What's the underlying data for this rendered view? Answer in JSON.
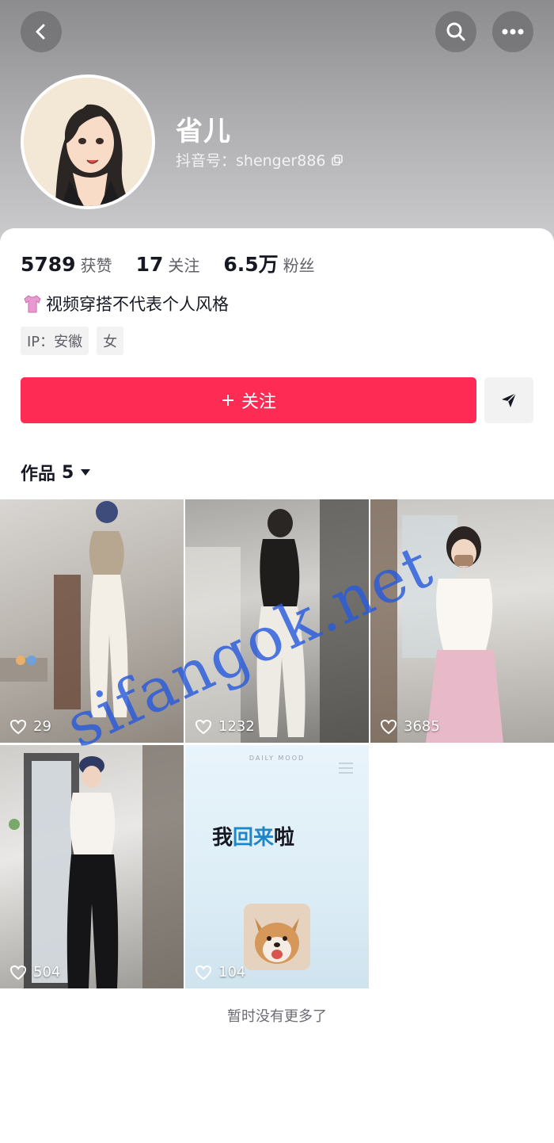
{
  "header": {
    "nickname": "省儿",
    "douyin_id": "抖音号：shenger886"
  },
  "stats": [
    {
      "value": "5789",
      "label": "获赞"
    },
    {
      "value": "17",
      "label": "关注"
    },
    {
      "value": "6.5万",
      "label": "粉丝"
    }
  ],
  "bio": "视频穿搭不代表个人风格",
  "tags": [
    "IP：安徽",
    "女"
  ],
  "follow_label": "关注",
  "works_tab": {
    "label": "作品",
    "count": "5"
  },
  "videos": [
    {
      "likes": "29"
    },
    {
      "likes": "1232"
    },
    {
      "likes": "3685"
    },
    {
      "likes": "504"
    },
    {
      "likes": "104",
      "headline_part1": "我",
      "headline_part2": "回来",
      "headline_part3": "啦",
      "caption": "DAILY MOOD"
    }
  ],
  "footer_text": "暂时没有更多了",
  "watermark": "sifangok.net",
  "colors": {
    "accent": "#fe2c55",
    "text": "#161823",
    "secondary": "#5f5f66"
  }
}
